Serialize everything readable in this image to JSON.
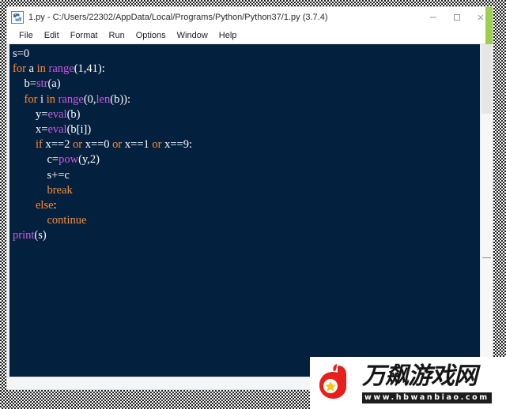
{
  "window": {
    "title": "1.py - C:/Users/22302/AppData/Local/Programs/Python/Python37/1.py (3.7.4)",
    "icon": "python-idle-icon",
    "controls": {
      "minimize": "minimize-icon",
      "maximize": "maximize-icon",
      "close": "close-icon"
    },
    "accent_color": "#9ccf4f"
  },
  "menubar": {
    "items": [
      {
        "label": "File"
      },
      {
        "label": "Edit"
      },
      {
        "label": "Format"
      },
      {
        "label": "Run"
      },
      {
        "label": "Options"
      },
      {
        "label": "Window"
      },
      {
        "label": "Help"
      }
    ]
  },
  "editor": {
    "background_color": "#04203f",
    "foreground_color": "#ffffff",
    "keyword_color": "#ff8d28",
    "builtin_color": "#c75ce0",
    "lines": [
      {
        "indent": 0,
        "tokens": [
          {
            "t": "s=0",
            "c": "plain"
          }
        ]
      },
      {
        "indent": 0,
        "tokens": [
          {
            "t": "for",
            "c": "kw"
          },
          {
            "t": " a ",
            "c": "plain"
          },
          {
            "t": "in",
            "c": "kw"
          },
          {
            "t": " ",
            "c": "plain"
          },
          {
            "t": "range",
            "c": "bi"
          },
          {
            "t": "(1,41):",
            "c": "plain"
          }
        ]
      },
      {
        "indent": 1,
        "tokens": [
          {
            "t": "b=",
            "c": "plain"
          },
          {
            "t": "str",
            "c": "bi"
          },
          {
            "t": "(a)",
            "c": "plain"
          }
        ]
      },
      {
        "indent": 1,
        "tokens": [
          {
            "t": "for",
            "c": "kw"
          },
          {
            "t": " i ",
            "c": "plain"
          },
          {
            "t": "in",
            "c": "kw"
          },
          {
            "t": " ",
            "c": "plain"
          },
          {
            "t": "range",
            "c": "bi"
          },
          {
            "t": "(0,",
            "c": "plain"
          },
          {
            "t": "len",
            "c": "bi"
          },
          {
            "t": "(b)):",
            "c": "plain"
          }
        ]
      },
      {
        "indent": 2,
        "tokens": [
          {
            "t": "y=",
            "c": "plain"
          },
          {
            "t": "eval",
            "c": "bi"
          },
          {
            "t": "(b)",
            "c": "plain"
          }
        ]
      },
      {
        "indent": 2,
        "tokens": [
          {
            "t": "x=",
            "c": "plain"
          },
          {
            "t": "eval",
            "c": "bi"
          },
          {
            "t": "(b[i])",
            "c": "plain"
          }
        ]
      },
      {
        "indent": 2,
        "tokens": [
          {
            "t": "if",
            "c": "kw"
          },
          {
            "t": " x==2 ",
            "c": "plain"
          },
          {
            "t": "or",
            "c": "kw"
          },
          {
            "t": " x==0 ",
            "c": "plain"
          },
          {
            "t": "or",
            "c": "kw"
          },
          {
            "t": " x==1 ",
            "c": "plain"
          },
          {
            "t": "or",
            "c": "kw"
          },
          {
            "t": " x==9:",
            "c": "plain"
          }
        ]
      },
      {
        "indent": 3,
        "tokens": [
          {
            "t": "c=",
            "c": "plain"
          },
          {
            "t": "pow",
            "c": "bi"
          },
          {
            "t": "(y,2)",
            "c": "plain"
          }
        ]
      },
      {
        "indent": 3,
        "tokens": [
          {
            "t": "s+=c",
            "c": "plain"
          }
        ]
      },
      {
        "indent": 3,
        "tokens": [
          {
            "t": "break",
            "c": "kw"
          }
        ]
      },
      {
        "indent": 2,
        "tokens": [
          {
            "t": "else",
            "c": "kw"
          },
          {
            "t": ":",
            "c": "plain"
          }
        ]
      },
      {
        "indent": 3,
        "tokens": [
          {
            "t": "continue",
            "c": "kw"
          }
        ]
      },
      {
        "indent": 0,
        "tokens": [
          {
            "t": "print",
            "c": "bi"
          },
          {
            "t": "(s)",
            "c": "plain"
          }
        ]
      }
    ],
    "plain_text": "s=0\nfor a in range(1,41):\n    b=str(a)\n    for i in range(0,len(b)):\n        y=eval(b)\n        x=eval(b[i])\n        if x==2 or x==0 or x==1 or x==9:\n            c=pow(y,2)\n            s+=c\n            break\n        else:\n            continue\nprint(s)"
  },
  "scrollbars": {
    "vertical": {
      "name": "vertical-scrollbar"
    },
    "horizontal": {
      "name": "horizontal-scrollbar"
    }
  },
  "watermark": {
    "site_name": "万飙游戏网",
    "url": "www.hbwanbiao.com",
    "logo": "red-heart-hand-logo",
    "logo_color": "#e8201c",
    "star_color": "#f5c518"
  }
}
